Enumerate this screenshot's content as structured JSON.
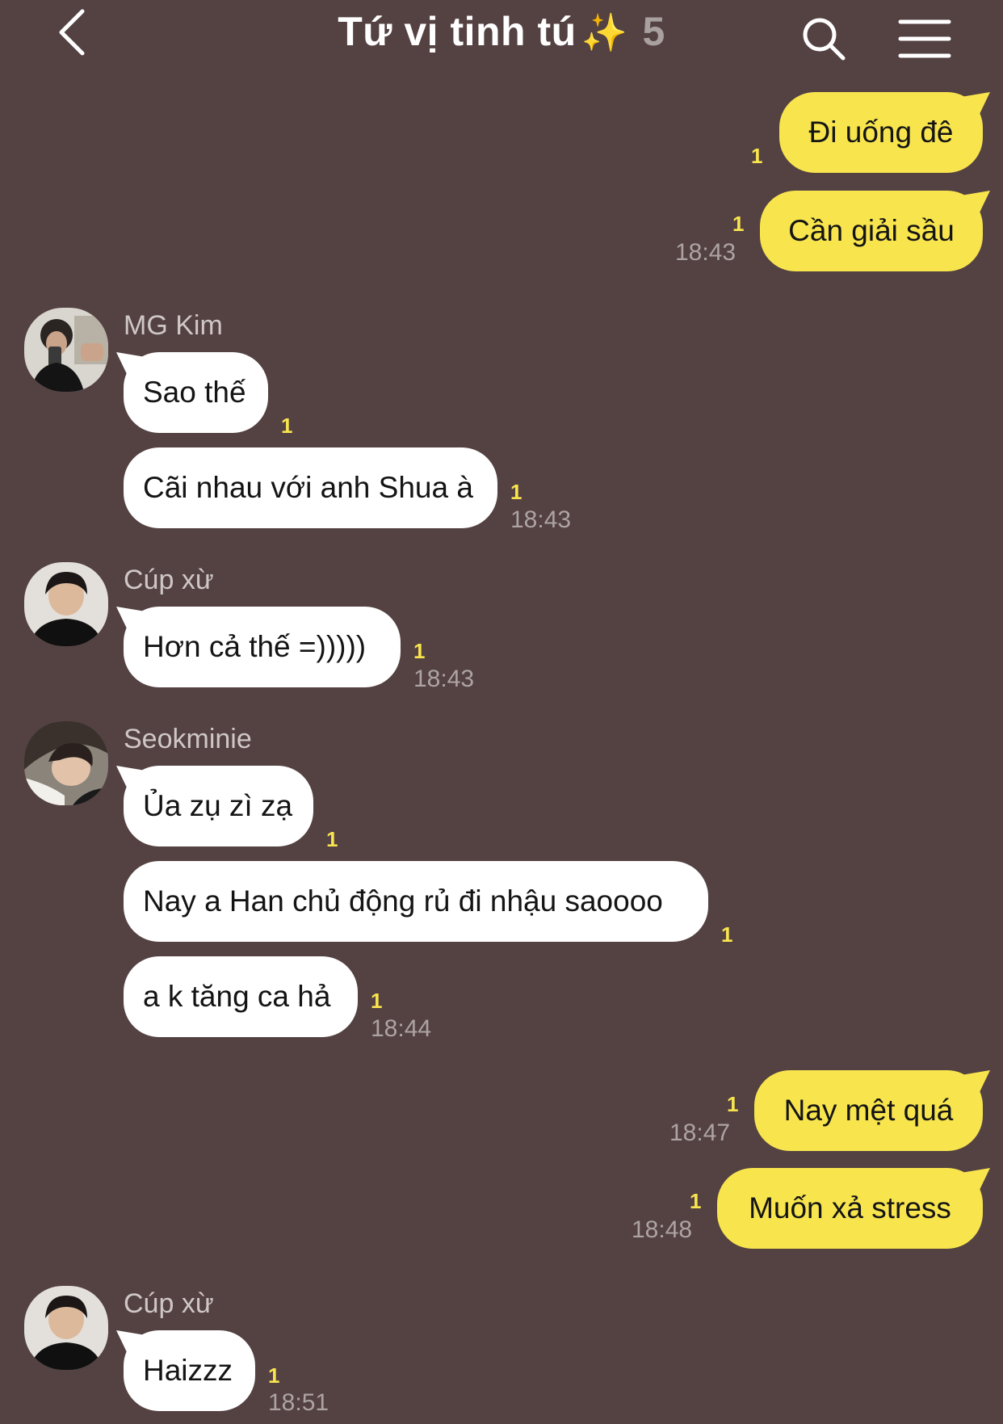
{
  "header": {
    "title": "Tứ vị tinh tú",
    "title_emoji": "✨",
    "member_count": "5",
    "icons": [
      "back-arrow-icon",
      "search-icon",
      "menu-icon"
    ]
  },
  "colors": {
    "background": "#544142",
    "outgoing_bubble": "#f8e54e",
    "incoming_bubble": "#ffffff",
    "unread_count": "#f8e54e"
  },
  "messages": [
    {
      "text": "Đi uống đê",
      "unread": "1"
    },
    {
      "text": "Cần giải sầu",
      "unread": "1",
      "time": "18:43"
    },
    {
      "sender": "MG Kim",
      "text": "Sao thế",
      "unread": "1"
    },
    {
      "text": "Cãi nhau với anh Shua à",
      "unread": "1",
      "time": "18:43"
    },
    {
      "sender": "Cúp xừ",
      "text": "Hơn cả thế =)))))",
      "unread": "1",
      "time": "18:43"
    },
    {
      "sender": "Seokminie",
      "text": "Ủa zụ zì zạ",
      "unread": "1"
    },
    {
      "text": "Nay a Han chủ động rủ đi nhậu saoooo",
      "unread": "1"
    },
    {
      "text": "a k tăng ca hả",
      "unread": "1",
      "time": "18:44"
    },
    {
      "text": "Nay mệt quá",
      "unread": "1",
      "time": "18:47"
    },
    {
      "text": "Muốn xả stress",
      "unread": "1",
      "time": "18:48"
    },
    {
      "sender": "Cúp xừ",
      "text": "Haizzz",
      "unread": "1",
      "time": "18:51"
    }
  ]
}
